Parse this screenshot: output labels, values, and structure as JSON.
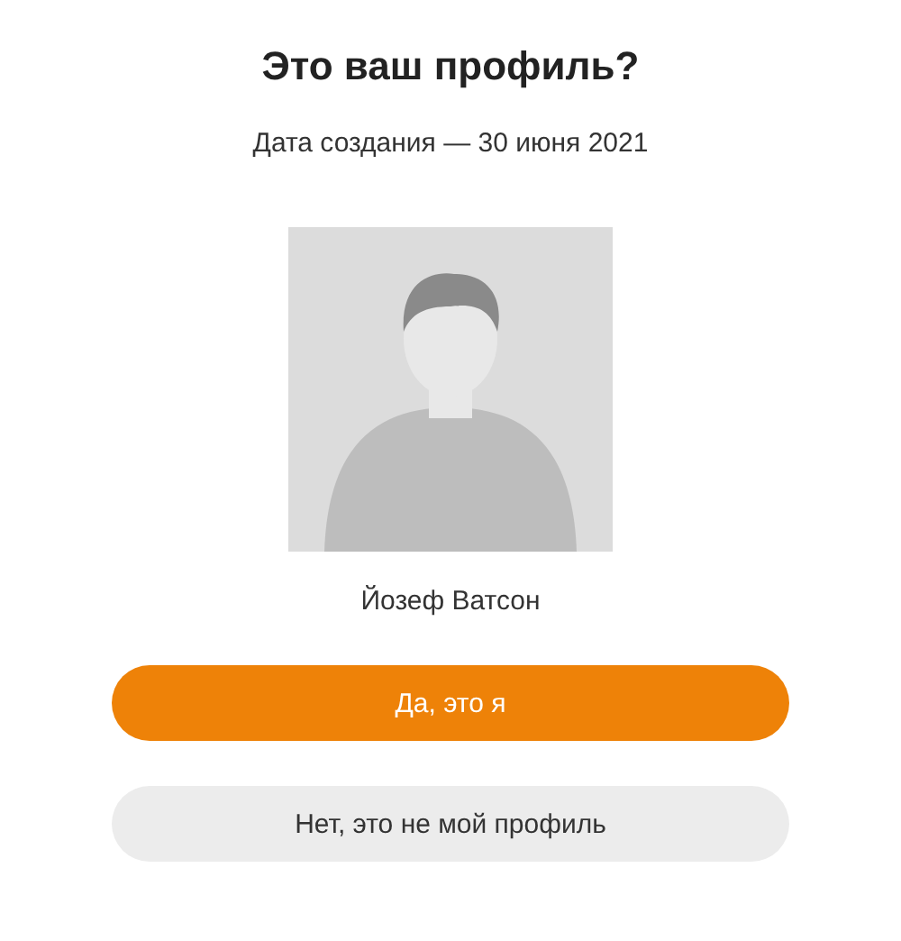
{
  "title": "Это ваш профиль?",
  "created": "Дата создания — 30 июня 2021",
  "avatar": {
    "kind": "placeholder"
  },
  "name": "Йозеф Ватсон",
  "buttons": [
    {
      "label": "Да, это я",
      "kind": "primary"
    },
    {
      "label": "Нет, это не мой профиль",
      "kind": "secondary"
    }
  ]
}
